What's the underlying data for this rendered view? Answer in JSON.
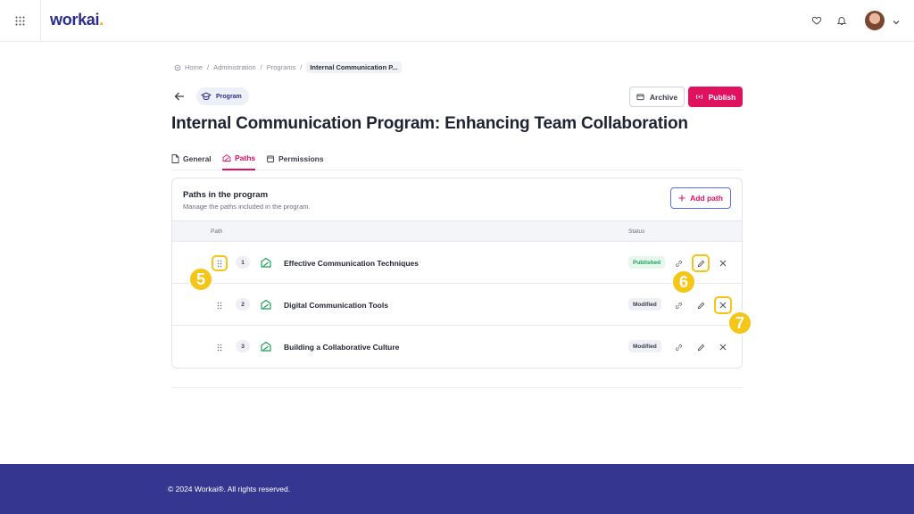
{
  "header": {
    "logo": "workai",
    "logo_dot": ".",
    "icons": [
      "apps-grid-icon",
      "heart-icon",
      "bell-icon",
      "chevron-down-icon"
    ]
  },
  "breadcrumb": [
    "Home",
    "Administration",
    "Programs",
    "Internal Communication P..."
  ],
  "chip_label": "Program",
  "buttons": {
    "archive": "Archive",
    "publish": "Publish",
    "add_path": "Add path"
  },
  "title": "Internal Communication Program: Enhancing Team Collaboration",
  "tabs": [
    {
      "label": "General",
      "icon": "document-icon",
      "active": false
    },
    {
      "label": "Paths",
      "icon": "path-icon",
      "active": true
    },
    {
      "label": "Permissions",
      "icon": "permissions-icon",
      "active": false
    }
  ],
  "card": {
    "title": "Paths in the program",
    "subtitle": "Manage the paths included in the program."
  },
  "table": {
    "headers": {
      "path": "Path",
      "status": "Status"
    },
    "rows": [
      {
        "num": "1",
        "name": "Effective Communication Techniques",
        "status": "Published"
      },
      {
        "num": "2",
        "name": "Digital Communication Tools",
        "status": "Modified"
      },
      {
        "num": "3",
        "name": "Building a Collaborative Culture",
        "status": "Modified"
      }
    ]
  },
  "callouts": [
    "5",
    "6",
    "7"
  ],
  "footer": "© 2024 Workai®. All rights reserved.",
  "colors": {
    "accent": "#e0115f",
    "brand": "#2b2e88",
    "footer": "#353690",
    "highlight": "#f5c518",
    "published": "#1e9e5a"
  }
}
